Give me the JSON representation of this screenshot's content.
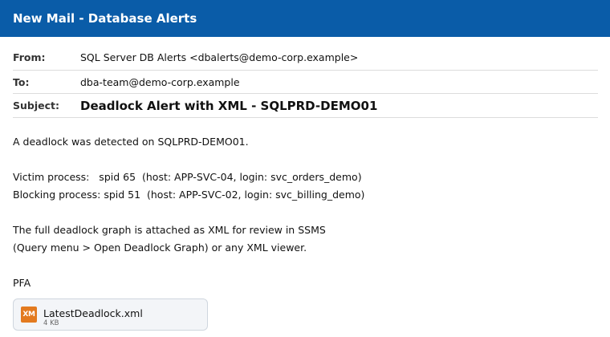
{
  "window": {
    "title": "New Mail - Database Alerts"
  },
  "headers": {
    "from_label": "From:",
    "from_value": "SQL Server DB Alerts <dbalerts@demo-corp.example>",
    "to_label": "To:",
    "to_value": "dba-team@demo-corp.example",
    "subject_label": "Subject:",
    "subject_value": "Deadlock Alert with XML - SQLPRD-DEMO01"
  },
  "body": {
    "line1": "A deadlock was detected on SQLPRD-DEMO01.",
    "victim": "Victim process:   spid 65  (host: APP-SVC-04, login: svc_orders_demo)",
    "blocking": "Blocking process: spid 51  (host: APP-SVC-02, login: svc_billing_demo)",
    "graph_line1": "The full deadlock graph is attached as XML for review in SSMS",
    "graph_line2": "(Query menu > Open Deadlock Graph) or any XML viewer.",
    "signoff": "PFA"
  },
  "attachment": {
    "icon": "xml-file-icon",
    "icon_text": "XM",
    "icon_color": "#e37a1f",
    "name": "LatestDeadlock.xml",
    "size": "4 KB"
  },
  "colors": {
    "titlebar": "#0a5ca8"
  }
}
